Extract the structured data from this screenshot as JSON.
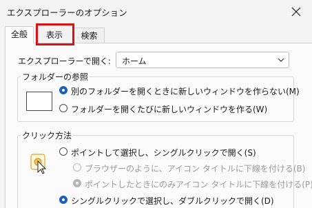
{
  "window": {
    "title": "エクスプローラーのオプション"
  },
  "tabs": [
    {
      "label": "全般",
      "selected": true
    },
    {
      "label": "表示",
      "selected": false,
      "highlighted": true
    },
    {
      "label": "検索",
      "selected": false
    }
  ],
  "open_explorer": {
    "label": "エクスプローラーで開く:",
    "value": "ホーム"
  },
  "folder_browse": {
    "legend": "フォルダーの参照",
    "options": [
      {
        "label": "別のフォルダーを開くときに新しいウィンドウを作らない(M)",
        "checked": true
      },
      {
        "label": "フォルダーを開くたびに新しいウィンドウを作る(W)",
        "checked": false
      }
    ]
  },
  "click_method": {
    "legend": "クリック方法",
    "options": [
      {
        "label": "ポイントして選択し、シングルクリックで開く(S)",
        "checked": false,
        "disabled": false
      },
      {
        "label": "ブラウザーのように、アイコン タイトルに下線を付ける(B)",
        "checked": false,
        "disabled": true
      },
      {
        "label": "ポイントしたときにのみアイコン タイトルに下線を付ける(P)",
        "checked": true,
        "disabled": true
      },
      {
        "label": "シングルクリックで選択し、ダブルクリックで開く(D)",
        "checked": true,
        "disabled": false
      }
    ]
  },
  "icons": {
    "close": "close-icon",
    "dropdown": "chevron-down-icon",
    "folder_window": "window-preview-icon",
    "click_cursor": "pointer-cursor-icon"
  },
  "colors": {
    "accent": "#1d5fbf",
    "highlight_box": "#e01010"
  }
}
